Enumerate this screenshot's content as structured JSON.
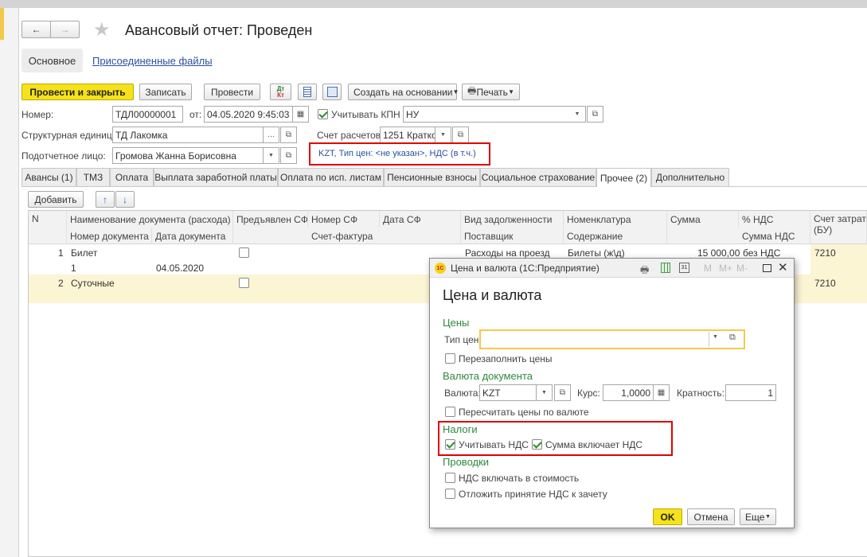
{
  "window": {
    "title": "Авансовый отчет: Проведен"
  },
  "nav": {
    "back": "←",
    "forward": "→"
  },
  "tabs_top": {
    "main": "Основное",
    "files": "Присоединенные файлы"
  },
  "toolbar": {
    "post_close": "Провести и закрыть",
    "save": "Записать",
    "post": "Провести",
    "dtkt": "Дт\nКт",
    "create_based": "Создать на основании",
    "print": "Печать"
  },
  "form": {
    "number_label": "Номер:",
    "number_value": "ТДЛ00000001",
    "date_label": "от:",
    "date_value": "04.05.2020  9:45:03",
    "kpn_label": "Учитывать КПН",
    "kpn_value": "НУ",
    "unit_label": "Структурная единица:",
    "unit_value": "ТД Лакомка",
    "account_label": "Счет расчетов:",
    "account_value": "1251 Кратко",
    "person_label": "Подотчетное лицо:",
    "person_value": "Громова Жанна Борисовна",
    "price_link": "KZT, Тип цен: <не указан>, НДС (в т.ч.)"
  },
  "tabs": [
    "Авансы (1)",
    "ТМЗ",
    "Оплата",
    "Выплата заработной платы",
    "Оплата по исп. листам",
    "Пенсионные взносы",
    "Социальное страхование",
    "Прочее (2)",
    "Дополнительно"
  ],
  "table_toolbar": {
    "add": "Добавить"
  },
  "table": {
    "headers_top": [
      "N",
      "Наименование документа (расхода)",
      "Предъявлен СФ",
      "Номер СФ",
      "Дата СФ",
      "Вид задолженности",
      "Номенклатура",
      "Сумма",
      "% НДС",
      "Счет затрат (БУ)"
    ],
    "headers_bottom": [
      "Номер документа",
      "Дата документа",
      "Счет-фактура",
      "Поставщик",
      "Содержание",
      "Сумма НДС"
    ],
    "rows": [
      {
        "n": "1",
        "name": "Билет",
        "doc_no": "1",
        "doc_date": "04.05.2020",
        "debt": "Расходы на проезд",
        "nomen": "Билеты (ж\\д)",
        "sum": "15 000,00",
        "vat": "без НДС",
        "acc": "7210"
      },
      {
        "n": "2",
        "name": "Суточные",
        "acc": "7210"
      }
    ]
  },
  "dialog": {
    "app_title": "Цена и валюта  (1С:Предприятие)",
    "title": "Цена и валюта",
    "prices_section": "Цены",
    "price_type_label": "Тип цен:",
    "refill_prices": "Перезаполнить цены",
    "currency_section": "Валюта документа",
    "currency_label": "Валюта:",
    "currency_value": "KZT",
    "rate_label": "Курс:",
    "rate_value": "1,0000",
    "mult_label": "Кратность:",
    "mult_value": "1",
    "recalc": "Пересчитать цены по валюте",
    "taxes_section": "Налоги",
    "use_vat": "Учитывать НДС",
    "sum_incl_vat": "Сумма включает НДС",
    "postings_section": "Проводки",
    "vat_in_cost": "НДС включать в стоимость",
    "defer_vat": "Отложить принятие НДС к зачету",
    "ok": "OK",
    "cancel": "Отмена",
    "more": "Еще",
    "m": "M",
    "mplus": "M+",
    "mminus": "M-"
  },
  "colors": {
    "accent": "#f6e21a",
    "link": "#2b4fa0",
    "section": "#2d8a3e",
    "highlight": "#e00000",
    "row_selected": "#fbf5d4"
  }
}
